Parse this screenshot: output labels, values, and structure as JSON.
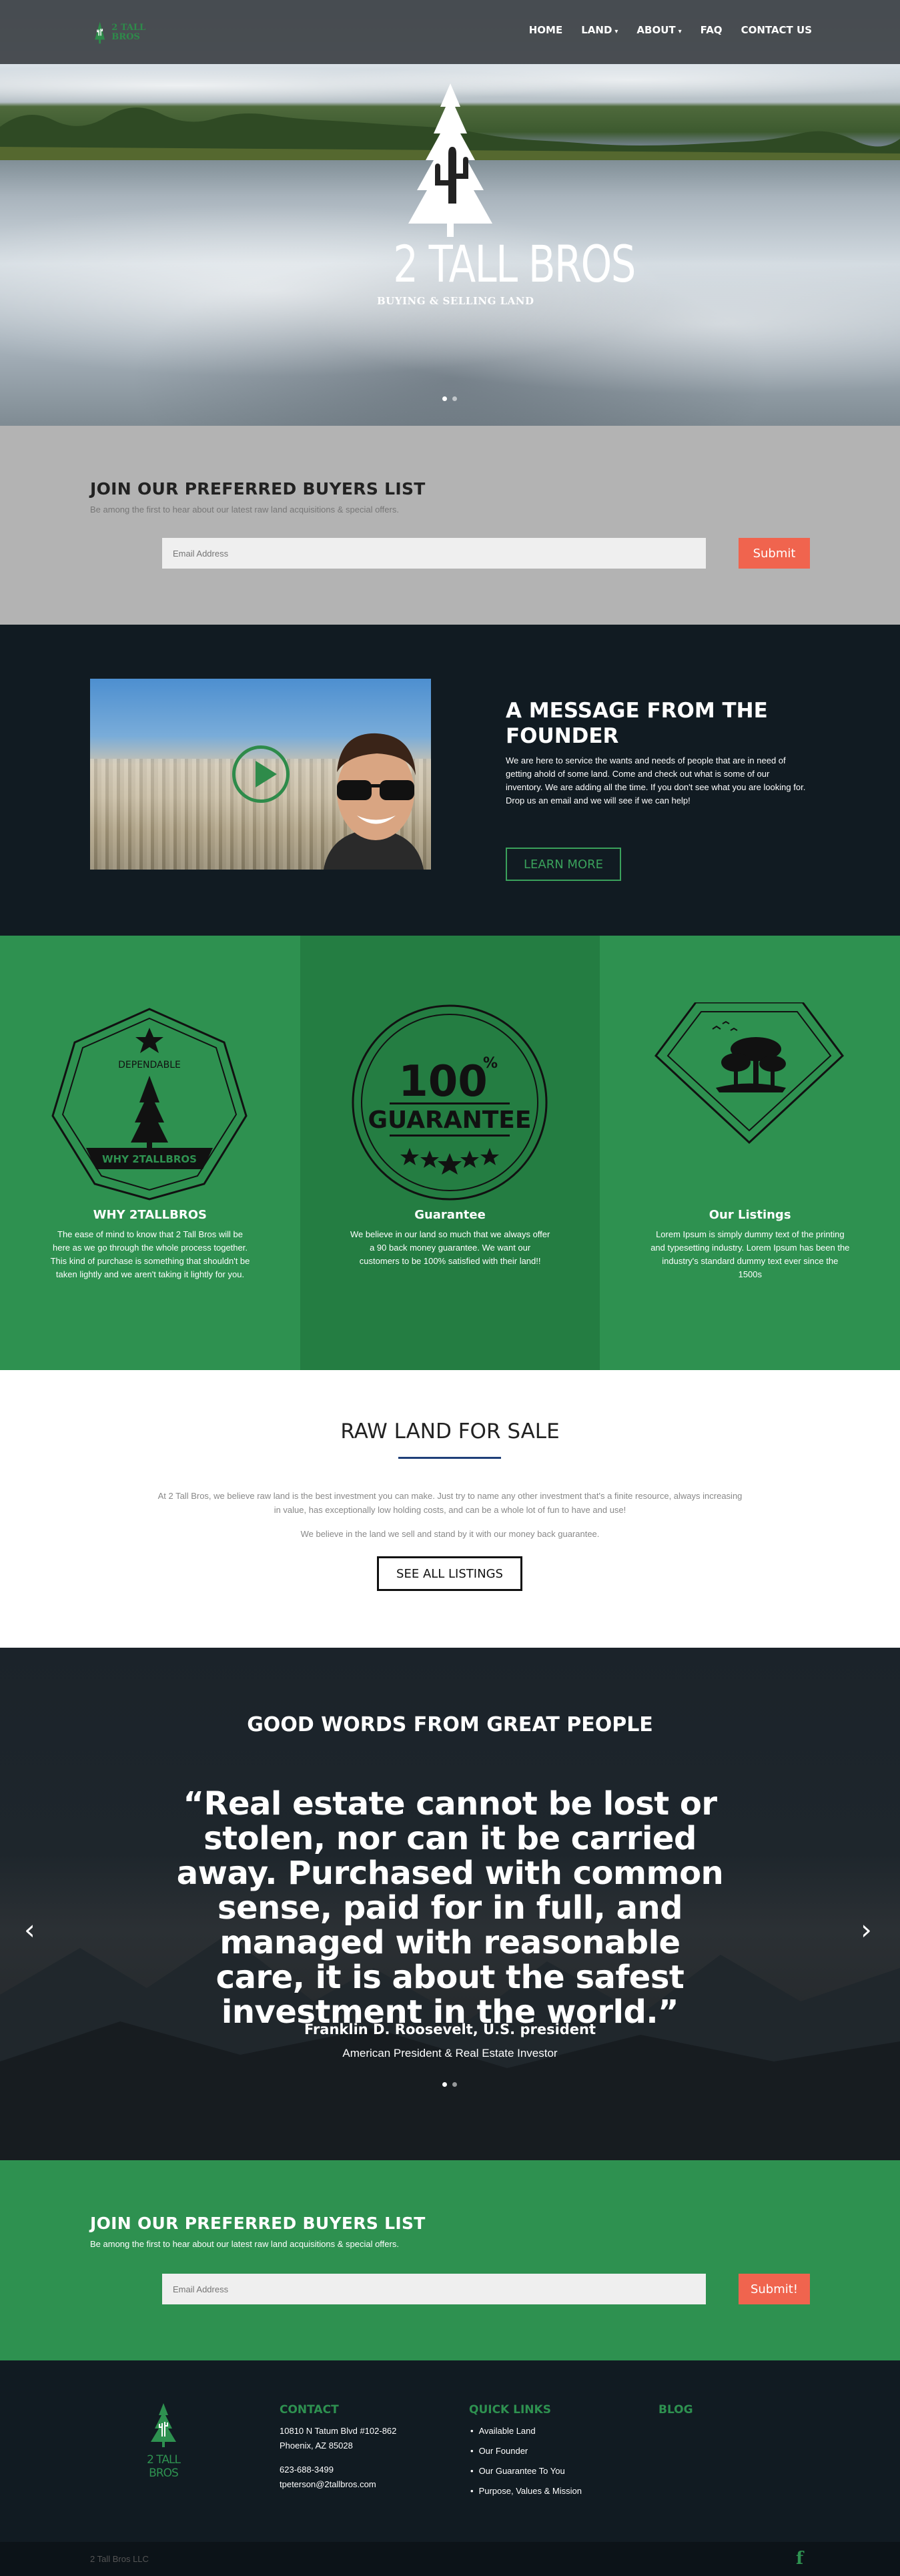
{
  "header": {
    "logo_text": "2 TALL BROS",
    "nav": [
      {
        "label": "HOME",
        "has_dropdown": false
      },
      {
        "label": "LAND",
        "has_dropdown": true
      },
      {
        "label": "ABOUT",
        "has_dropdown": true
      },
      {
        "label": "FAQ",
        "has_dropdown": false
      },
      {
        "label": "CONTACT US",
        "has_dropdown": false
      }
    ]
  },
  "hero": {
    "title": "2 TALL BROS",
    "subtitle": "BUYING & SELLING LAND",
    "slides_count": 2,
    "active_slide": 1
  },
  "buyers_list_top": {
    "title": "JOIN OUR PREFERRED BUYERS LIST",
    "subtitle": "Be among the first to hear about our latest raw land acquisitions & special offers.",
    "email_placeholder": "Email Address",
    "submit_label": "Submit"
  },
  "founder": {
    "title": "A MESSAGE FROM THE FOUNDER",
    "body": "We are here to service the wants and needs of people that are in need of getting ahold of some land. Come and check out what is some of our inventory. We are adding all the time. If you don't see what you are looking for. Drop us an email and we will see if we can help!",
    "button_label": "LEARN MORE"
  },
  "features": [
    {
      "badge_top": "DEPENDABLE",
      "badge_bottom": "WHY 2TALLBROS",
      "title": "WHY 2TALLBROS",
      "text": "The ease of mind to know that 2 Tall Bros will be here as we go through the whole process together. This kind of purchase is something that shouldn't be taken lightly and we aren't taking it lightly for you."
    },
    {
      "badge_number": "100",
      "badge_percent": "%",
      "badge_word": "GUARANTEE",
      "title": "Guarantee",
      "text": "We believe in our land so much that we always offer a 90 back money guarantee. We want our customers to be 100% satisfied with their land!!"
    },
    {
      "title": "Our Listings",
      "text": "Lorem Ipsum is simply dummy text of the printing and typesetting industry. Lorem Ipsum has been the industry's standard dummy text ever since the 1500s"
    }
  ],
  "raw_land": {
    "title": "RAW LAND FOR SALE",
    "p1": "At 2 Tall Bros, we believe raw land is the best investment you can make. Just try to name any other investment that's a finite resource, always increasing in value, has exceptionally low holding costs, and can be a whole lot of fun to have and use!",
    "p2": "We believe in the land we sell and stand by it with our money back guarantee.",
    "button_label": "SEE ALL LISTINGS"
  },
  "testimonial": {
    "heading": "GOOD WORDS FROM GREAT PEOPLE",
    "quote": "“Real estate cannot be lost or stolen, nor can it be carried away. Purchased with common sense, paid for in full, and managed with reasonable care, it is about the safest investment in the world.”",
    "author": "Franklin D. Roosevelt, U.S. president",
    "role": "American President & Real Estate Investor",
    "prev_arrow": "‹",
    "next_arrow": "›"
  },
  "buyers_list_bottom": {
    "title": "JOIN OUR PREFERRED BUYERS LIST",
    "subtitle": "Be among the first to hear about our latest raw land acquisitions & special offers.",
    "email_placeholder": "Email Address",
    "submit_label": "Submit!"
  },
  "footer": {
    "logo_text": "2 TALL BROS",
    "contact_title": "CONTACT",
    "address_line1": "10810 N Tatum Blvd #102-862",
    "address_line2": "Phoenix, AZ 85028",
    "phone": "623-688-3499",
    "email": "tpeterson@2tallbros.com",
    "quick_links_title": "QUICK LINKS",
    "quick_links": [
      "Available Land",
      "Our Founder",
      "Our Guarantee To You",
      "Purpose, Values & Mission"
    ],
    "blog_title": "BLOG",
    "copyright": "2 Tall Bros LLC",
    "social_icon": "f"
  },
  "colors": {
    "brand_green": "#2e9150",
    "dark_navy": "#111b22",
    "submit_orange": "#f0644e",
    "gray_section": "#b3b3b3"
  }
}
